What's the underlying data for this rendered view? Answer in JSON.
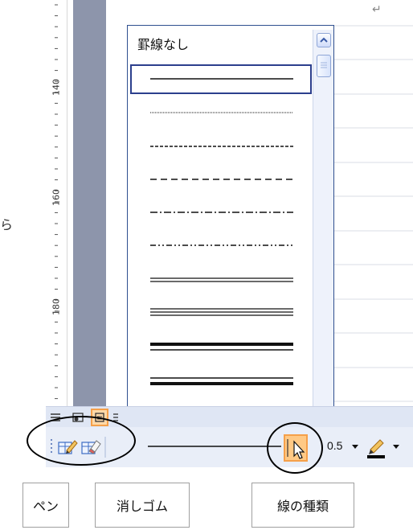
{
  "document": {
    "ruler_labels": [
      "140",
      "160",
      "180"
    ],
    "return_mark": "↵",
    "stray_char": "ら"
  },
  "line_style_dropdown": {
    "no_border_label": "罫線なし",
    "selected_index": 0,
    "options": [
      {
        "style": "solid-thin"
      },
      {
        "style": "dotted-fine"
      },
      {
        "style": "dashed-small"
      },
      {
        "style": "dashed-long"
      },
      {
        "style": "dash-dot"
      },
      {
        "style": "dash-dot-dot"
      },
      {
        "style": "double-thin"
      },
      {
        "style": "triple-thin"
      },
      {
        "style": "thick-thin"
      },
      {
        "style": "thin-thick"
      },
      {
        "style": "thick-thin-thick"
      }
    ]
  },
  "toolbar": {
    "pen_icon": "pen-icon",
    "eraser_icon": "eraser-icon",
    "line_style_icon": "line-style-button-icon",
    "line_weight_value": "0.5",
    "border_color_icon": "pencil-color-icon"
  },
  "labels": {
    "pen": "ペン",
    "eraser": "消しゴム",
    "line_style": "線の種類"
  },
  "colors": {
    "accent_orange": "#f5a04a",
    "selection_blue": "#2c3f8d",
    "ruler_strip": "#8d95ab"
  }
}
